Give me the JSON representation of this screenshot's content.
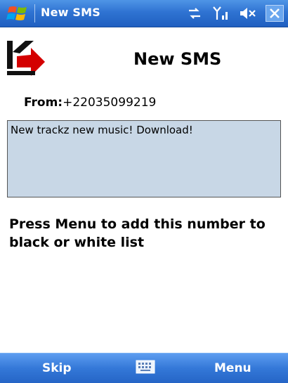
{
  "window": {
    "title": "New SMS",
    "icons": [
      "windows-flag-icon",
      "connectivity-icon",
      "signal-icon",
      "volume-muted-icon",
      "close-icon"
    ]
  },
  "header": {
    "logo": "kaspersky-k-logo",
    "title": "New SMS"
  },
  "message": {
    "from_label": "From:",
    "from_number": "+22035099219",
    "body": "New trackz new music! Download!"
  },
  "hint": {
    "text": "Press Menu to add this number to black or white list"
  },
  "softkeys": {
    "left": "Skip",
    "center_icon": "keyboard-icon",
    "right": "Menu"
  },
  "colors": {
    "titlebar": "#2f73d2",
    "message_box": "#c8d7e6",
    "logo_red": "#d40000"
  }
}
